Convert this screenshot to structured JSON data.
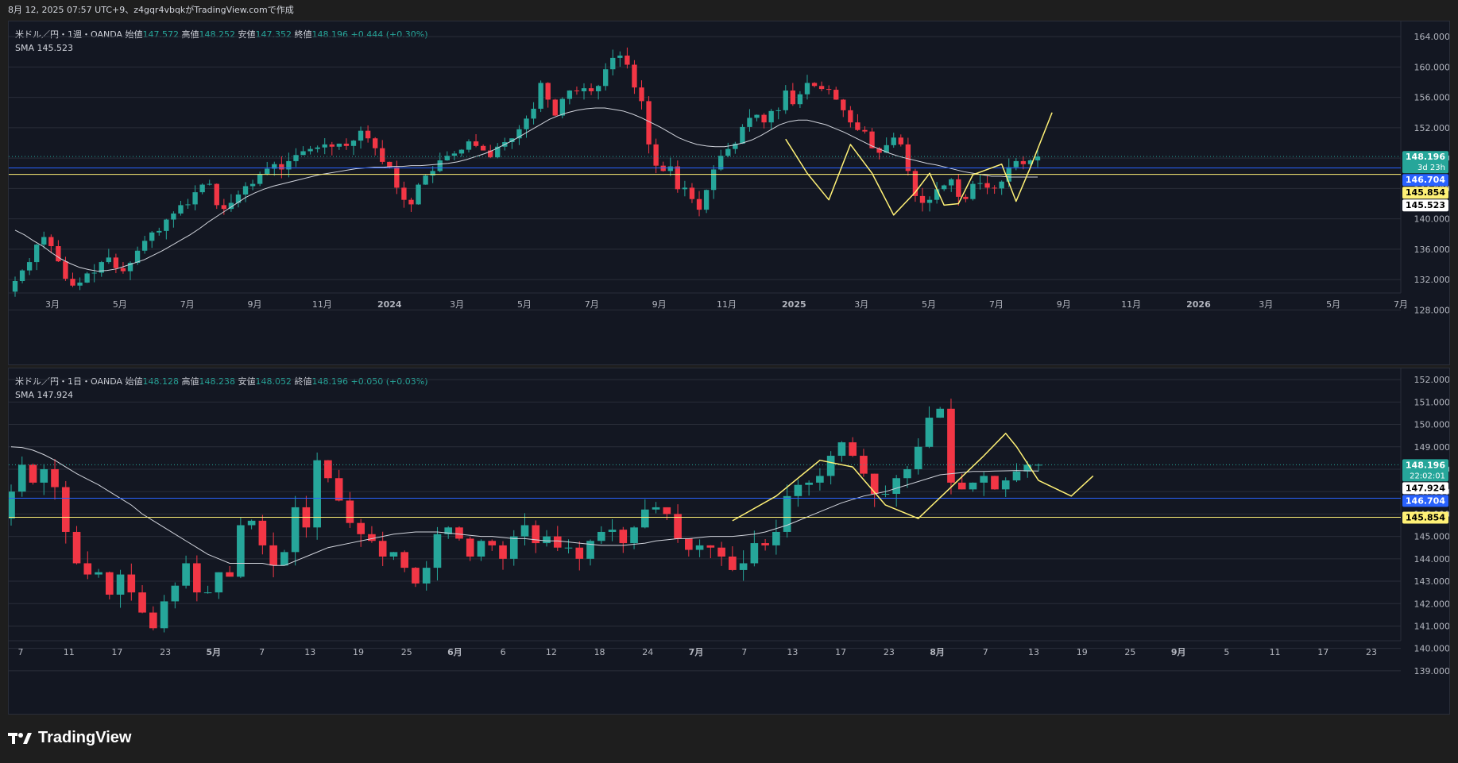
{
  "header": {
    "text": "8月 12, 2025 07:57 UTC+9、z4gqr4vbqkがTradingView.comで作成"
  },
  "footer": {
    "brand": "TradingView"
  },
  "colors": {
    "up": "#26a69a",
    "down": "#f23645",
    "sma": "#d1d4dc",
    "blue_line": "#2962ff",
    "yellow_line": "#fff176",
    "bg": "#131722",
    "grid": "#2a2e39"
  },
  "weekly": {
    "legend": {
      "title": "米ドル／円・1週・OANDA",
      "open_label": "始値",
      "open": "147.572",
      "high_label": "高値",
      "high": "148.252",
      "low_label": "安値",
      "low": "147.352",
      "close_label": "終値",
      "close": "148.196",
      "change": "+0.444 (+0.30%)",
      "sma_label": "SMA",
      "sma_value": "145.523"
    },
    "price_tags": [
      {
        "text": "148.196",
        "sub": "3d 23h",
        "value": 148.196,
        "color": "#26a69a",
        "fg": "#ffffff"
      },
      {
        "text": "146.704",
        "value": 146.704,
        "color": "#2962ff",
        "fg": "#ffffff"
      },
      {
        "text": "145.854",
        "value": 145.854,
        "color": "#fff176",
        "fg": "#000000"
      },
      {
        "text": "145.523",
        "value": 145.523,
        "color": "#ffffff",
        "fg": "#000000"
      }
    ]
  },
  "daily": {
    "legend": {
      "title": "米ドル／円・1日・OANDA",
      "open_label": "始値",
      "open": "148.128",
      "high_label": "高値",
      "high": "148.238",
      "low_label": "安値",
      "low": "148.052",
      "close_label": "終値",
      "close": "148.196",
      "change": "+0.050 (+0.03%)",
      "sma_label": "SMA",
      "sma_value": "147.924"
    },
    "price_tags": [
      {
        "text": "148.196",
        "sub": "22:02:01",
        "value": 148.196,
        "color": "#26a69a",
        "fg": "#ffffff"
      },
      {
        "text": "147.924",
        "value": 147.924,
        "color": "#ffffff",
        "fg": "#000000"
      },
      {
        "text": "146.704",
        "value": 146.704,
        "color": "#2962ff",
        "fg": "#ffffff"
      },
      {
        "text": "145.854",
        "value": 145.854,
        "color": "#fff176",
        "fg": "#000000"
      }
    ]
  },
  "chart_data": [
    {
      "type": "candlestick",
      "title": "米ドル／円・1週・OANDA",
      "ylim": [
        125,
        166
      ],
      "y_ticks": [
        "164.000",
        "160.000",
        "156.000",
        "152.000",
        "148.000",
        "144.000",
        "140.000",
        "136.000",
        "132.000",
        "128.000"
      ],
      "x_ticks": [
        "3月",
        "5月",
        "7月",
        "9月",
        "11月",
        "2024",
        "3月",
        "5月",
        "7月",
        "9月",
        "11月",
        "2025",
        "3月",
        "5月",
        "7月",
        "9月",
        "11月",
        "2026",
        "3月",
        "5月",
        "7月"
      ],
      "hlines": [
        146.704,
        145.854
      ],
      "closes": [
        131.8,
        133.2,
        134.3,
        136.6,
        137.6,
        136.4,
        134.4,
        132.1,
        131.2,
        131.6,
        132.8,
        132.9,
        134.3,
        134.9,
        133.5,
        133.1,
        134.2,
        135.8,
        137.1,
        138.2,
        138.4,
        139.9,
        140.7,
        141.8,
        141.9,
        143.5,
        144.5,
        144.6,
        141.8,
        141.3,
        142.1,
        143.2,
        144.3,
        144.6,
        145.9,
        146.6,
        147.2,
        146.5,
        147.6,
        148.4,
        148.9,
        149.2,
        149.4,
        149.8,
        149.5,
        149.9,
        149.6,
        150.3,
        151.6,
        150.6,
        149.3,
        147.5,
        146.8,
        144.1,
        142.5,
        141.9,
        144.5,
        145.7,
        146.3,
        147.7,
        148.3,
        148.6,
        149.1,
        150.2,
        149.6,
        149.0,
        148.1,
        149.5,
        150.1,
        150.6,
        151.8,
        153.2,
        154.5,
        157.9,
        155.7,
        153.6,
        155.8,
        156.9,
        156.8,
        157.2,
        156.8,
        157.5,
        159.7,
        161.2,
        161.5,
        160.3,
        157.3,
        155.5,
        149.8,
        147.0,
        146.3,
        146.9,
        143.9,
        144.1,
        142.6,
        141.2,
        143.8,
        146.5,
        148.3,
        149.2,
        149.9,
        152.1,
        153.3,
        153.7,
        152.7,
        154.2,
        154.3,
        156.9,
        155.1,
        156.4,
        157.9,
        157.5,
        157.1,
        157.0,
        155.7,
        154.3,
        152.7,
        151.7,
        151.5,
        149.3,
        148.7,
        149.7,
        150.7,
        149.8,
        146.3,
        143.0,
        142.1,
        142.5,
        143.9,
        144.4,
        145.2,
        142.9,
        142.6,
        144.6,
        144.7,
        144.1,
        144.0,
        144.9,
        146.8,
        147.6,
        147.2,
        147.7,
        148.2
      ],
      "sma": [
        138.5,
        137.9,
        137.1,
        136.4,
        135.5,
        134.7,
        134.1,
        133.6,
        133.3,
        133.1,
        133.2,
        133.4,
        133.8,
        134.2,
        134.6,
        135.2,
        135.8,
        136.5,
        137.2,
        137.9,
        138.7,
        139.6,
        140.4,
        141.2,
        142.0,
        142.8,
        143.4,
        143.9,
        144.3,
        144.6,
        144.9,
        145.2,
        145.5,
        145.8,
        146.0,
        146.2,
        146.4,
        146.6,
        146.7,
        146.8,
        146.8,
        146.9,
        146.9,
        147.0,
        147.0,
        147.1,
        147.2,
        147.3,
        147.5,
        147.8,
        148.2,
        148.6,
        149.1,
        149.7,
        150.3,
        151.0,
        151.7,
        152.4,
        153.1,
        153.6,
        154.0,
        154.3,
        154.5,
        154.6,
        154.6,
        154.4,
        154.2,
        153.8,
        153.3,
        152.7,
        152.1,
        151.4,
        150.7,
        150.2,
        149.8,
        149.6,
        149.5,
        149.5,
        149.7,
        150.0,
        150.4,
        151.0,
        151.7,
        152.4,
        152.8,
        153.0,
        153.0,
        152.7,
        152.4,
        151.9,
        151.4,
        150.8,
        150.2,
        149.6,
        149.1,
        148.6,
        148.2,
        147.9,
        147.6,
        147.3,
        147.1,
        146.8,
        146.5,
        146.2,
        146.0,
        145.8,
        145.6,
        145.6,
        145.5,
        145.5,
        145.5,
        145.5
      ]
    },
    {
      "type": "candlestick",
      "title": "米ドル／円・1日・OANDA",
      "ylim": [
        138.5,
        152.5
      ],
      "y_ticks": [
        "152.000",
        "151.000",
        "150.000",
        "149.000",
        "148.000",
        "147.000",
        "146.000",
        "145.000",
        "144.000",
        "143.000",
        "142.000",
        "141.000",
        "140.000",
        "139.000"
      ],
      "x_ticks": [
        "7",
        "11",
        "17",
        "23",
        "5月",
        "7",
        "13",
        "19",
        "25",
        "6月",
        "6",
        "12",
        "18",
        "24",
        "7月",
        "7",
        "13",
        "17",
        "23",
        "8月",
        "7",
        "13",
        "19",
        "25",
        "9月",
        "5",
        "11",
        "17",
        "23"
      ],
      "hlines": [
        146.704,
        145.854
      ],
      "closes": [
        147.0,
        148.2,
        147.4,
        148.0,
        147.2,
        145.2,
        143.8,
        143.3,
        143.4,
        142.4,
        143.3,
        142.5,
        141.6,
        140.9,
        142.1,
        142.8,
        143.8,
        142.5,
        142.5,
        143.4,
        143.2,
        145.5,
        145.7,
        144.6,
        143.7,
        144.3,
        146.3,
        145.4,
        148.4,
        147.6,
        146.6,
        145.6,
        145.1,
        144.8,
        144.1,
        144.3,
        143.6,
        142.9,
        143.6,
        145.1,
        145.4,
        144.9,
        144.1,
        144.8,
        144.6,
        144.0,
        145.0,
        145.5,
        144.7,
        145.0,
        144.5,
        144.5,
        144.0,
        144.8,
        145.2,
        145.3,
        144.7,
        145.4,
        146.2,
        146.3,
        146.0,
        144.9,
        144.4,
        144.6,
        144.5,
        144.1,
        143.5,
        143.8,
        144.7,
        144.6,
        145.2,
        146.8,
        147.3,
        147.4,
        147.7,
        148.6,
        149.2,
        148.6,
        147.8,
        146.9,
        146.9,
        147.6,
        148.0,
        149.0,
        150.3,
        150.7,
        147.4,
        147.1,
        147.4,
        147.7,
        147.1,
        147.5,
        147.9,
        148.2,
        148.2
      ],
      "sma": [
        149.0,
        148.97,
        148.85,
        148.65,
        148.4,
        148.1,
        147.8,
        147.55,
        147.3,
        147.0,
        146.7,
        146.4,
        146.0,
        145.7,
        145.4,
        145.1,
        144.8,
        144.5,
        144.2,
        144.0,
        143.8,
        143.8,
        143.8,
        143.8,
        143.7,
        143.7,
        143.9,
        144.1,
        144.3,
        144.5,
        144.6,
        144.7,
        144.8,
        144.9,
        145.0,
        145.1,
        145.15,
        145.2,
        145.2,
        145.2,
        145.15,
        145.1,
        145.05,
        145.0,
        145.0,
        144.95,
        144.9,
        144.9,
        144.85,
        144.8,
        144.8,
        144.75,
        144.7,
        144.65,
        144.6,
        144.6,
        144.6,
        144.65,
        144.7,
        144.8,
        144.85,
        144.9,
        144.9,
        144.95,
        145.0,
        145.0,
        145.0,
        145.05,
        145.1,
        145.2,
        145.35,
        145.5,
        145.7,
        145.9,
        146.1,
        146.3,
        146.5,
        146.65,
        146.8,
        146.9,
        147.0,
        147.15,
        147.3,
        147.45,
        147.6,
        147.75,
        147.8,
        147.85,
        147.9,
        147.9,
        147.92,
        147.93,
        147.94,
        147.93,
        147.92
      ]
    }
  ]
}
